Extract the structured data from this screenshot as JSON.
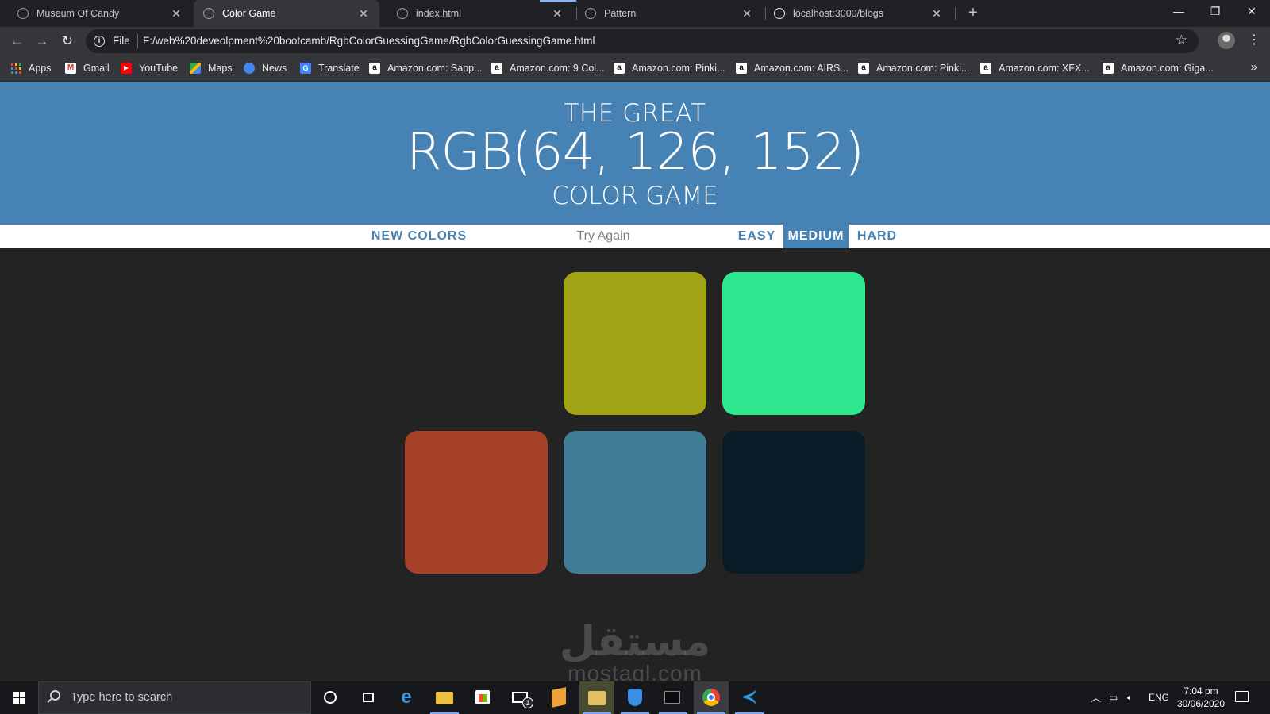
{
  "browser": {
    "tabs": [
      {
        "title": "Museum Of Candy",
        "active": false
      },
      {
        "title": "Color Game",
        "active": true
      },
      {
        "title": "index.html",
        "active": false
      },
      {
        "title": "Pattern",
        "active": false
      },
      {
        "title": "localhost:3000/blogs",
        "active": false
      }
    ],
    "scheme_label": "File",
    "url": "F:/web%20deveolpment%20bootcamb/RgbColorGuessingGame/RgbColorGuessingGame.html",
    "bookmarks": [
      {
        "label": "Apps",
        "icon": "apps-grid-icon"
      },
      {
        "label": "Gmail",
        "icon": "gmail-icon"
      },
      {
        "label": "YouTube",
        "icon": "youtube-icon"
      },
      {
        "label": "Maps",
        "icon": "maps-icon"
      },
      {
        "label": "News",
        "icon": "news-icon"
      },
      {
        "label": "Translate",
        "icon": "translate-icon"
      },
      {
        "label": "Amazon.com: Sapp...",
        "icon": "amazon-icon"
      },
      {
        "label": "Amazon.com: 9 Col...",
        "icon": "amazon-icon"
      },
      {
        "label": "Amazon.com: Pinki...",
        "icon": "amazon-icon"
      },
      {
        "label": "Amazon.com: AIRS...",
        "icon": "amazon-icon"
      },
      {
        "label": "Amazon.com: Pinki...",
        "icon": "amazon-icon"
      },
      {
        "label": "Amazon.com: XFX...",
        "icon": "amazon-icon"
      },
      {
        "label": "Amazon.com: Giga...",
        "icon": "amazon-icon"
      }
    ]
  },
  "game": {
    "header_line1": "THE GREAT",
    "target_color": "RGB(64, 126, 152)",
    "header_line3": "COLOR GAME",
    "new_colors_label": "NEW COLORS",
    "message": "Try Again",
    "modes": [
      {
        "label": "EASY",
        "selected": false
      },
      {
        "label": "MEDIUM",
        "selected": true
      },
      {
        "label": "HARD",
        "selected": false
      }
    ],
    "header_bg": "#4682b4",
    "page_bg": "#232323",
    "squares": [
      {
        "color": "#232323",
        "hidden": true
      },
      {
        "color": "#9fa314",
        "hidden": false
      },
      {
        "color": "#2ee68d",
        "hidden": false
      },
      {
        "color": "#a8412a",
        "hidden": false
      },
      {
        "color": "#407e98",
        "hidden": false
      },
      {
        "color": "#081b26",
        "hidden": false
      }
    ]
  },
  "watermark": {
    "arabic": "مستقل",
    "latin": "mostaql.com"
  },
  "taskbar": {
    "search_placeholder": "Type here to search",
    "language": "ENG",
    "time": "7:04 pm",
    "date": "30/06/2020",
    "mail_badge": "1",
    "pinned": [
      "cortana-icon",
      "task-view-icon",
      "edge-icon",
      "file-explorer-icon",
      "store-icon",
      "mail-icon",
      "sublime-text-icon",
      "video-editor-icon",
      "vpn-shield-icon",
      "terminal-icon",
      "chrome-icon",
      "vscode-icon"
    ]
  }
}
